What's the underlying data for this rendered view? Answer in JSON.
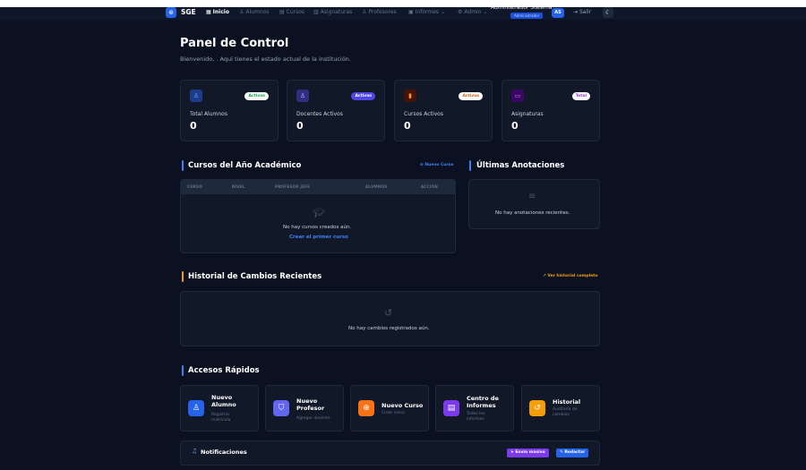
{
  "nav": {
    "brand": "SGE",
    "items": [
      {
        "icon": "▦",
        "label": "Inicio"
      },
      {
        "icon": "♙",
        "label": "Alumnos"
      },
      {
        "icon": "▤",
        "label": "Cursos"
      },
      {
        "icon": "▥",
        "label": "Asignaturas"
      },
      {
        "icon": "♙",
        "label": "Profesores"
      },
      {
        "icon": "▣",
        "label": "Informes"
      },
      {
        "icon": "⚙",
        "label": "Admin"
      }
    ],
    "user_name": "Administrador Sistema",
    "user_role": "Administrador",
    "avatar": "AS",
    "logout": "Salir"
  },
  "header": {
    "title": "Panel de Control",
    "subtitle": "Bienvenido, . Aquí tienes el estado actual de la institución."
  },
  "stats": [
    {
      "badge": "Activos",
      "label": "Total Alumnos",
      "value": "0",
      "color": "#2563eb",
      "badge_color": "#16a34a"
    },
    {
      "badge": "Activos",
      "label": "Docentes Activos",
      "value": "0",
      "color": "#4f46e5",
      "badge_color": "#4f46e5"
    },
    {
      "badge": "Activos",
      "label": "Cursos Activos",
      "value": "0",
      "color": "#ea580c",
      "badge_color": "#ea580c"
    },
    {
      "badge": "Total",
      "label": "Asignaturas",
      "value": "0",
      "color": "#9333ea",
      "badge_color": "#9333ea"
    }
  ],
  "courses": {
    "title": "Cursos del Año Académico",
    "new_link": "⊕ Nuevo Curso",
    "columns": [
      "CURSO",
      "NIVEL",
      "PROFESOR JEFE",
      "ALUMNOS",
      "ACCIÓN"
    ],
    "empty": "No hay cursos creados aún.",
    "create": "Crear el primer curso"
  },
  "notes": {
    "title": "Últimas Anotaciones",
    "empty": "No hay anotaciones recientes."
  },
  "history": {
    "title": "Historial de Cambios Recientes",
    "link": "↗ Ver historial completo",
    "empty": "No hay cambios registrados aún."
  },
  "quick": {
    "title": "Accesos Rápidos",
    "items": [
      {
        "title": "Nuevo Alumno",
        "sub": "Registrar matrícula",
        "color": "#2563eb"
      },
      {
        "title": "Nuevo Profesor",
        "sub": "Agregar docente",
        "color": "#6366f1"
      },
      {
        "title": "Nuevo Curso",
        "sub": "Crear curso",
        "color": "#f97316"
      },
      {
        "title": "Centro de Informes",
        "sub": "Todos los informes",
        "color": "#7c3aed"
      },
      {
        "title": "Historial",
        "sub": "Auditoría de cambios",
        "color": "#f59e0b"
      }
    ]
  },
  "notifications": {
    "title": "Notificaciones",
    "btn_mass": "➤ Envío masivo",
    "btn_write": "✎ Redactar"
  }
}
